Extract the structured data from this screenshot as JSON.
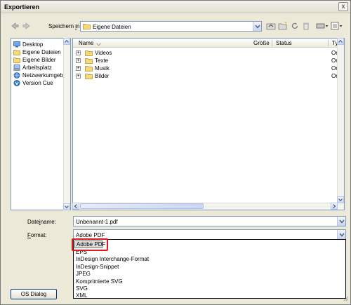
{
  "window": {
    "title": "Exportieren",
    "close_label": "x"
  },
  "toolbar": {
    "save_in_prefix": "Speichern ",
    "save_in_accel": "i",
    "save_in_suffix": "n:",
    "location": "Eigene Dateien"
  },
  "places": [
    {
      "label": "Desktop",
      "icon": "desktop-icon"
    },
    {
      "label": "Eigene Dateien",
      "icon": "folder-icon"
    },
    {
      "label": "Eigene Bilder",
      "icon": "folder-icon"
    },
    {
      "label": "Arbeitsplatz",
      "icon": "computer-icon"
    },
    {
      "label": "Netzwerkumgebur",
      "icon": "network-icon"
    },
    {
      "label": "Version Cue",
      "icon": "version-cue-icon"
    }
  ],
  "filelist": {
    "columns": {
      "name": "Name",
      "size": "Größe",
      "status": "Status",
      "type": "Typ"
    },
    "rows": [
      {
        "name": "Videos",
        "type": "Or"
      },
      {
        "name": "Texte",
        "type": "Or"
      },
      {
        "name": "Musik",
        "type": "Or"
      },
      {
        "name": "Bilder",
        "type": "Or"
      }
    ]
  },
  "filename": {
    "label_prefix": "Date",
    "label_accel": "i",
    "label_suffix": "name:",
    "value": "Unbenannt-1.pdf"
  },
  "format": {
    "label_accel": "F",
    "label_suffix": "ormat:",
    "value": "Adobe PDF",
    "options": [
      "Adobe PDF",
      "EPS",
      "InDesign Interchange-Format",
      "InDesign-Snippet",
      "JPEG",
      "Komprimierte SVG",
      "SVG",
      "XML"
    ]
  },
  "buttons": {
    "os_dialog": "OS Dialog"
  },
  "colors": {
    "highlight": "#e11919",
    "dialog_bg": "#ece9d8",
    "field_border": "#7f9db9"
  }
}
